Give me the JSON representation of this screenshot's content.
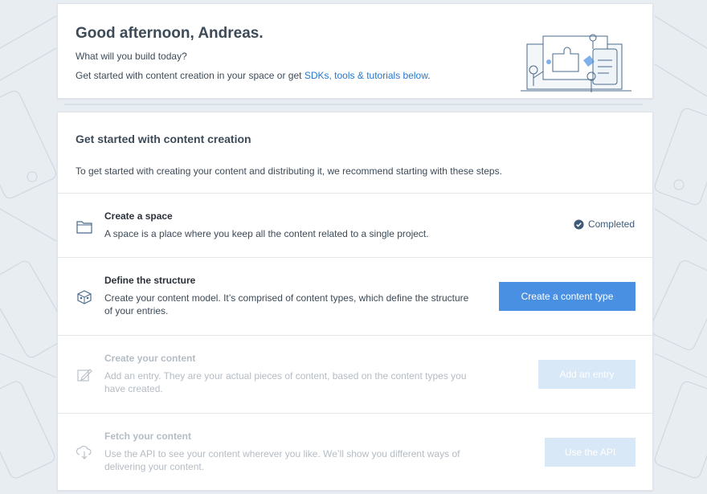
{
  "welcome": {
    "greeting": "Good afternoon, Andreas.",
    "question": "What will you build today?",
    "line_prefix": "Get started with content creation in your space or get ",
    "line_link": "SDKs, tools & tutorials below",
    "line_suffix": "."
  },
  "main": {
    "title": "Get started with content creation",
    "intro": "To get started with creating your content and distributing it, we recommend starting with these steps."
  },
  "steps": [
    {
      "title": "Create a space",
      "description": "A space is a place where you keep all the content related to a single project.",
      "status": "Completed",
      "icon": "folder-icon"
    },
    {
      "title": "Define the structure",
      "description": "Create your content model. It’s comprised of content types, which define the structure of your entries.",
      "button": "Create a content type",
      "icon": "box-icon"
    },
    {
      "title": "Create your content",
      "description": "Add an entry. They are your actual pieces of content, based on the content types you have created.",
      "button": "Add an entry",
      "icon": "pencil-icon"
    },
    {
      "title": "Fetch your content",
      "description": "Use the API to see your content wherever you like. We’ll show you different ways of delivering your content.",
      "button": "Use the API",
      "icon": "cloud-download-icon"
    }
  ],
  "colors": {
    "accent": "#4a90e2",
    "link": "#2478cc",
    "completed": "#3d5a78",
    "disabled_button": "#d8e8f7"
  }
}
